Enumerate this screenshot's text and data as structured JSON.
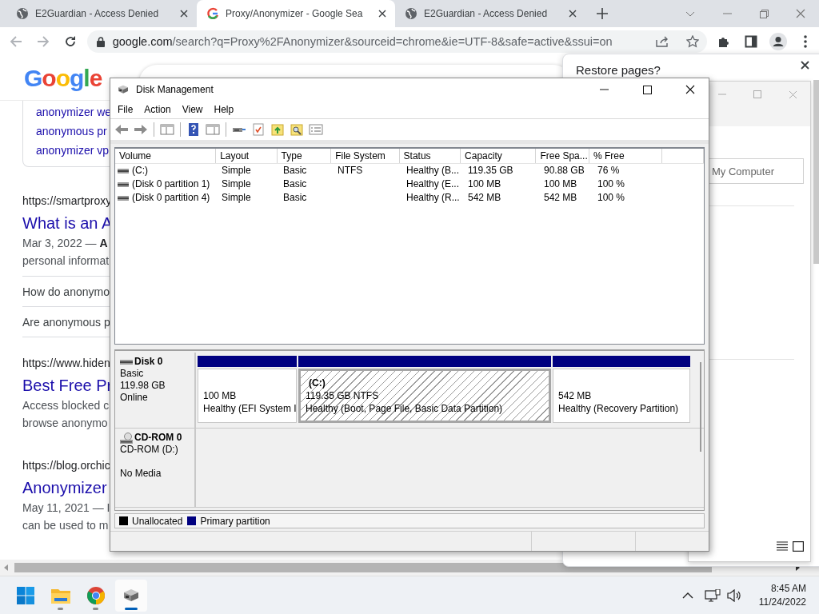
{
  "browser": {
    "tabs": [
      {
        "title": "E2Guardian - Access Denied",
        "kind": "globe",
        "selected": false
      },
      {
        "title": "Proxy/Anonymizer - Google Sea",
        "kind": "google",
        "selected": true
      },
      {
        "title": "E2Guardian - Access Denied",
        "kind": "globe",
        "selected": false
      }
    ],
    "url_host": "google.com",
    "url_rest": "/search?q=Proxy%2FAnonymizer&sourceid=chrome&ie=UTF-8&safe=active&ssui=on"
  },
  "google": {
    "logo": "Google",
    "related": [
      "anonymizer we",
      "anonymous pr",
      "anonymizer vp"
    ],
    "results": [
      {
        "kind": "result",
        "url": "https://smartproxy",
        "title": "What is an A",
        "lines": [
          "Mar 3, 2022 — **A**",
          "personal informat"
        ]
      },
      {
        "kind": "question",
        "text": "How do anonymo"
      },
      {
        "kind": "question",
        "text": "Are anonymous p"
      },
      {
        "kind": "result",
        "url": "https://www.hiden",
        "title": "Best Free Pr",
        "lines": [
          "Access blocked c",
          "browse anonymo"
        ]
      },
      {
        "kind": "result",
        "url": "https://blog.orchic",
        "title": "Anonymizer",
        "lines": [
          "May 11, 2021 — I",
          "can be used to m"
        ]
      }
    ]
  },
  "restore_dialog": {
    "title": "Restore pages?"
  },
  "back_window": {
    "field_value": "My Computer"
  },
  "disk_management": {
    "title": "Disk Management",
    "menu": [
      "File",
      "Action",
      "View",
      "Help"
    ],
    "columns": [
      "Volume",
      "Layout",
      "Type",
      "File System",
      "Status",
      "Capacity",
      "Free Spa...",
      "% Free"
    ],
    "volumes": [
      {
        "cells": [
          "(C:)",
          "Simple",
          "Basic",
          "NTFS",
          "Healthy (B...",
          "119.35 GB",
          "90.88 GB",
          "76 %"
        ]
      },
      {
        "cells": [
          "(Disk 0 partition 1)",
          "Simple",
          "Basic",
          "",
          "Healthy (E...",
          "100 MB",
          "100 MB",
          "100 %"
        ]
      },
      {
        "cells": [
          "(Disk 0 partition 4)",
          "Simple",
          "Basic",
          "",
          "Healthy (R...",
          "542 MB",
          "542 MB",
          "100 %"
        ]
      }
    ],
    "disks": [
      {
        "kind": "disk",
        "name": "Disk 0",
        "type": "Basic",
        "size": "119.98 GB",
        "status": "Online",
        "partitions": [
          {
            "size": "100 MB",
            "status": "Healthy (EFI System I",
            "selected": false
          },
          {
            "label": "(C:)",
            "size": "119.35 GB NTFS",
            "status": "Healthy (Boot, Page File, Basic Data Partition)",
            "selected": true
          },
          {
            "size": "542 MB",
            "status": "Healthy (Recovery Partition)",
            "selected": false
          }
        ]
      },
      {
        "kind": "cdrom",
        "name": "CD-ROM 0",
        "type": "CD-ROM (D:)",
        "status": "No Media"
      }
    ],
    "legend": [
      {
        "label": "Unallocated",
        "color": "#000000"
      },
      {
        "label": "Primary partition",
        "color": "#000080"
      }
    ]
  },
  "taskbar": {
    "apps": [
      {
        "kind": "start",
        "active": false
      },
      {
        "kind": "explorer",
        "active": false
      },
      {
        "kind": "chrome",
        "active": false
      },
      {
        "kind": "diskmgmt",
        "active": true
      }
    ],
    "time": "8:45 AM",
    "date": "11/24/2022"
  }
}
